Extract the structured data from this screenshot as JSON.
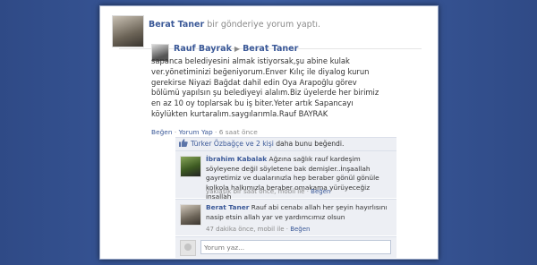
{
  "notification": {
    "author": "Berat Taner",
    "action_text": "bir gönderiye yorum yaptı."
  },
  "post": {
    "author": "Rauf Bayrak",
    "target": "Berat Taner",
    "body": "sapanca belediyesini almak istiyorsak,şu abine kulak ver.yönetiminizi beğeniyorum.Enver Kılıç ile diyalog kurun gerekirse Niyazi Bağdat dahil edin Oya Arapoğlu görev bölümü yapılsın şu belediyeyi alalım.Biz üyelerde her birimiz en az 10 oy toplarsak bu iş biter.Yeter artık Sapancayı köylükten kurtaralım.saygılarımla.Rauf BAYRAK",
    "like_link": "Beğen",
    "comment_link": "Yorum Yap",
    "time": "6 saat önce",
    "separator": "·"
  },
  "likes": {
    "text_before": "Türker Özbağçe ve",
    "link": "2 kişi",
    "text_after": "daha bunu beğendi."
  },
  "comments": [
    {
      "author": "İbrahim Kabalak",
      "text": "Ağzına sağlık rauf kardeşim söyleyene değil söyletene bak demişler..İnşaallah gayretimiz ve dualarınızla hep beraber gönül gönüle kolkola halkımızla beraber omakama yürüyeceğiz inşallah",
      "time": "yaklaşık bir saat önce",
      "via": "mobil ile",
      "like_link": "Beğen"
    },
    {
      "author": "Berat Taner",
      "text": "Rauf abi cenabı allah her şeyin hayırlısını nasip etsin allah yar ve yardımcımız olsun",
      "time": "47 dakika önce",
      "via": "mobil ile",
      "like_link": "Beğen"
    }
  ],
  "reply": {
    "placeholder": "Yorum yaz..."
  },
  "colors": {
    "background": "#3b5998",
    "link": "#3b5998",
    "comment_bg": "#edeff4"
  }
}
